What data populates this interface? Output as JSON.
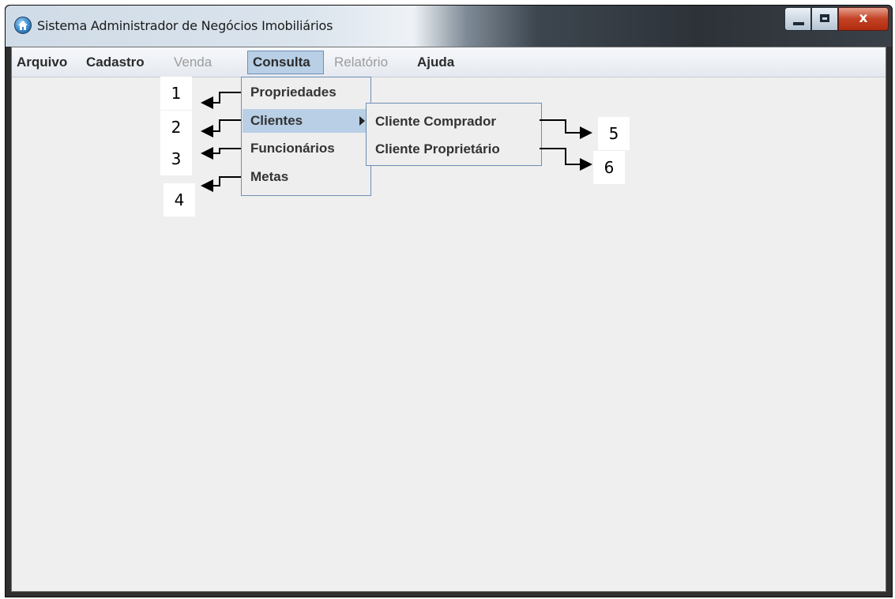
{
  "window": {
    "title": "Sistema Administrador de Negócios Imobiliários",
    "icon": "house-globe-icon",
    "controls": {
      "minimize": "minimize-icon",
      "maximize": "maximize-icon",
      "close_label": "x"
    }
  },
  "menubar": {
    "items": [
      {
        "label": "Arquivo",
        "enabled": true
      },
      {
        "label": "Cadastro",
        "enabled": true
      },
      {
        "label": "Venda",
        "enabled": false
      },
      {
        "label": "Consulta",
        "enabled": true,
        "open": true
      },
      {
        "label": "Relatório",
        "enabled": false
      },
      {
        "label": "Ajuda",
        "enabled": true
      }
    ]
  },
  "consulta_menu": {
    "items": [
      {
        "label": "Propriedades",
        "callout": "1"
      },
      {
        "label": "Clientes",
        "callout": "2",
        "has_submenu": true,
        "highlighted": true
      },
      {
        "label": "Funcionários",
        "callout": "3"
      },
      {
        "label": "Metas",
        "callout": "4"
      }
    ]
  },
  "clientes_submenu": {
    "items": [
      {
        "label": "Cliente Comprador",
        "callout": "5"
      },
      {
        "label": "Cliente Proprietário",
        "callout": "6"
      }
    ]
  },
  "colors": {
    "menu_highlight": "#b8cfe5",
    "menu_border": "#6d8fb3",
    "content_bg": "#efefef",
    "close_button": "#c44123"
  }
}
